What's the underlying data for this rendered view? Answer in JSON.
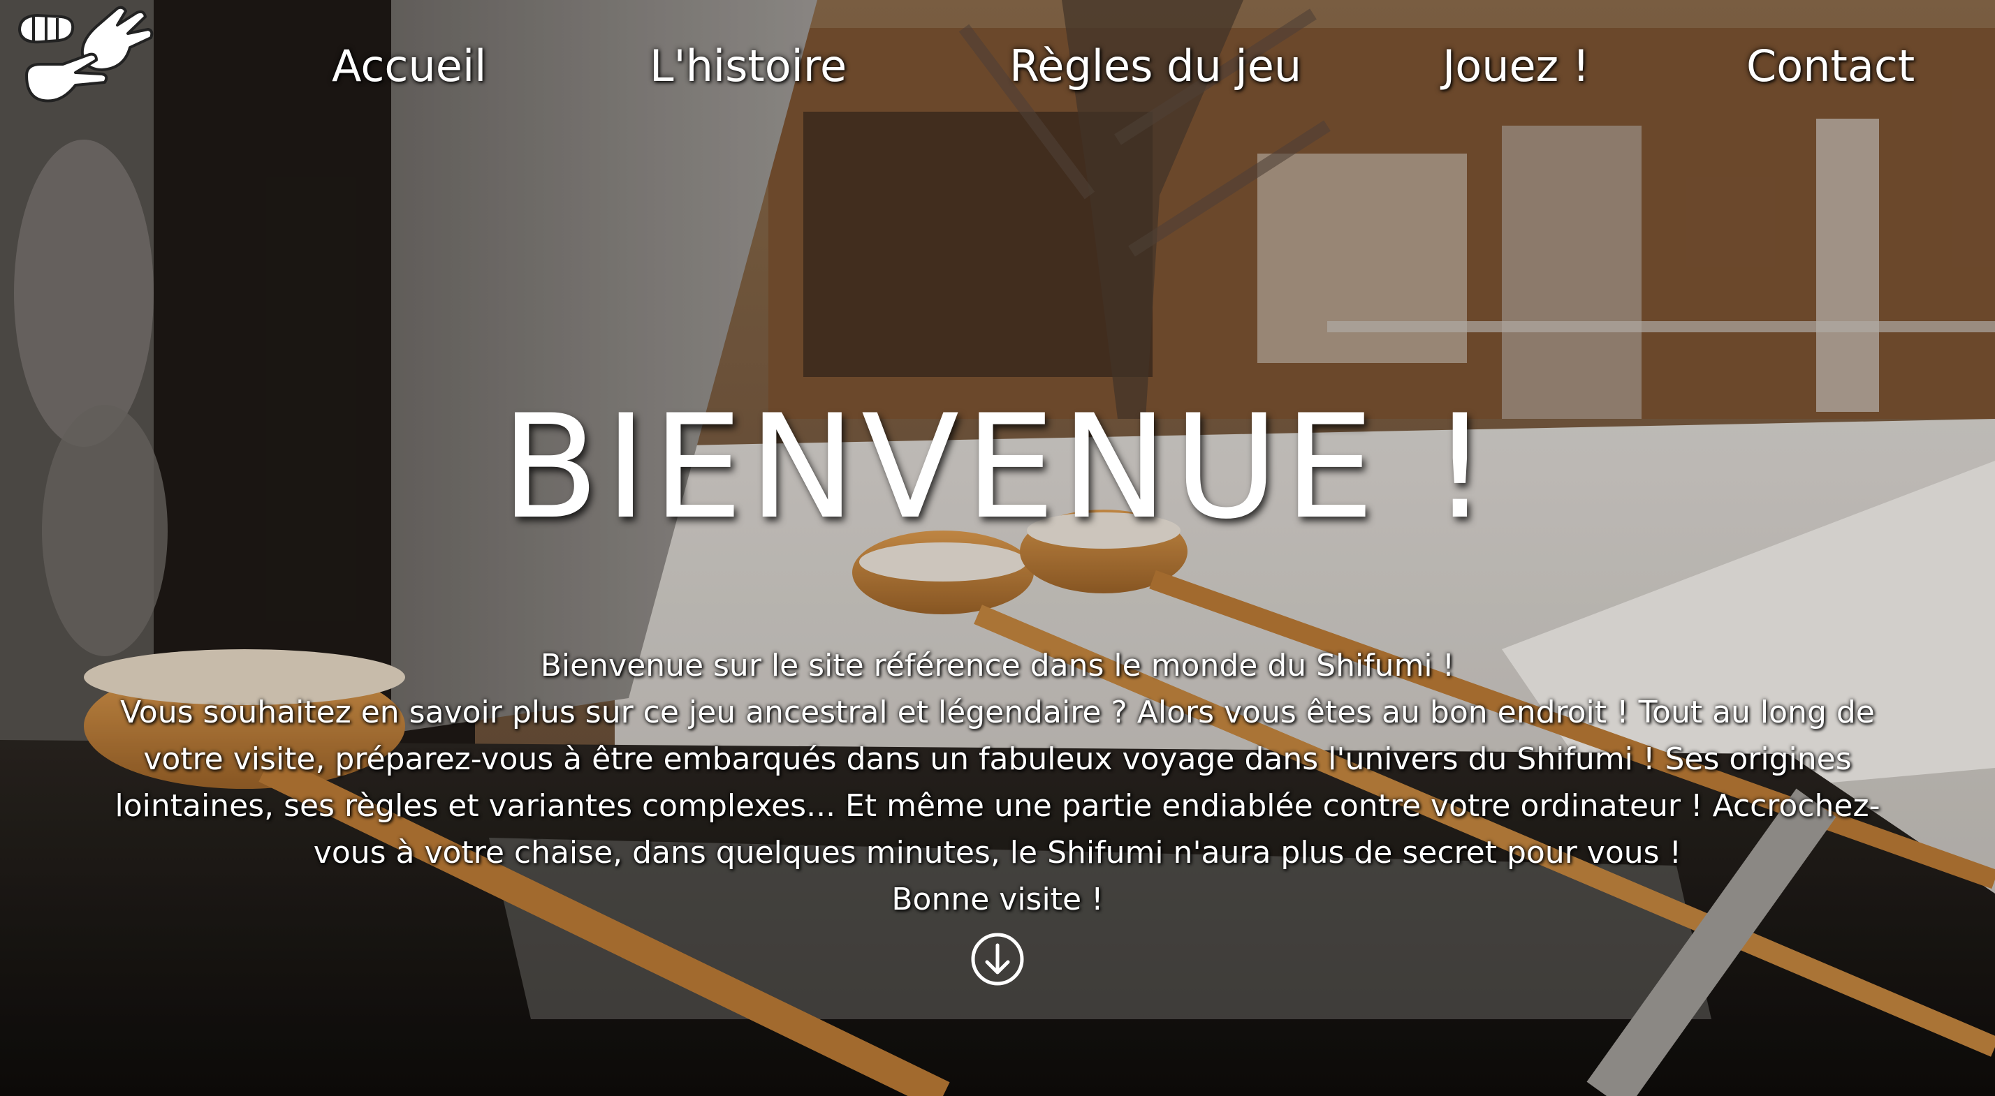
{
  "nav": {
    "logo_alt": "Shifumi",
    "items": [
      {
        "label": "Accueil"
      },
      {
        "label": "L'histoire"
      },
      {
        "label": "Règles du jeu"
      },
      {
        "label": "Jouez !"
      },
      {
        "label": "Contact"
      }
    ]
  },
  "hero": {
    "title": "BIENVENUE !",
    "intro": "Bienvenue sur le site référence dans le monde du Shifumi !",
    "body": "Vous souhaitez en savoir plus sur ce jeu ancestral et légendaire ? Alors vous êtes au bon endroit ! Tout au long de votre visite, préparez-vous à être embarqués dans un fabuleux voyage dans l'univers du Shifumi ! Ses origines lointaines, ses règles et variantes complexes... Et même une partie endiablée contre votre ordinateur ! Accrochez-vous à votre chaise, dans quelques minutes, le Shifumi n'aura plus de secret pour vous !",
    "closing": "Bonne visite !",
    "scroll_icon": "arrow-down-circle-icon"
  },
  "colors": {
    "text": "#ffffff",
    "wood": "#c9873f",
    "snow": "#e6e3df"
  }
}
